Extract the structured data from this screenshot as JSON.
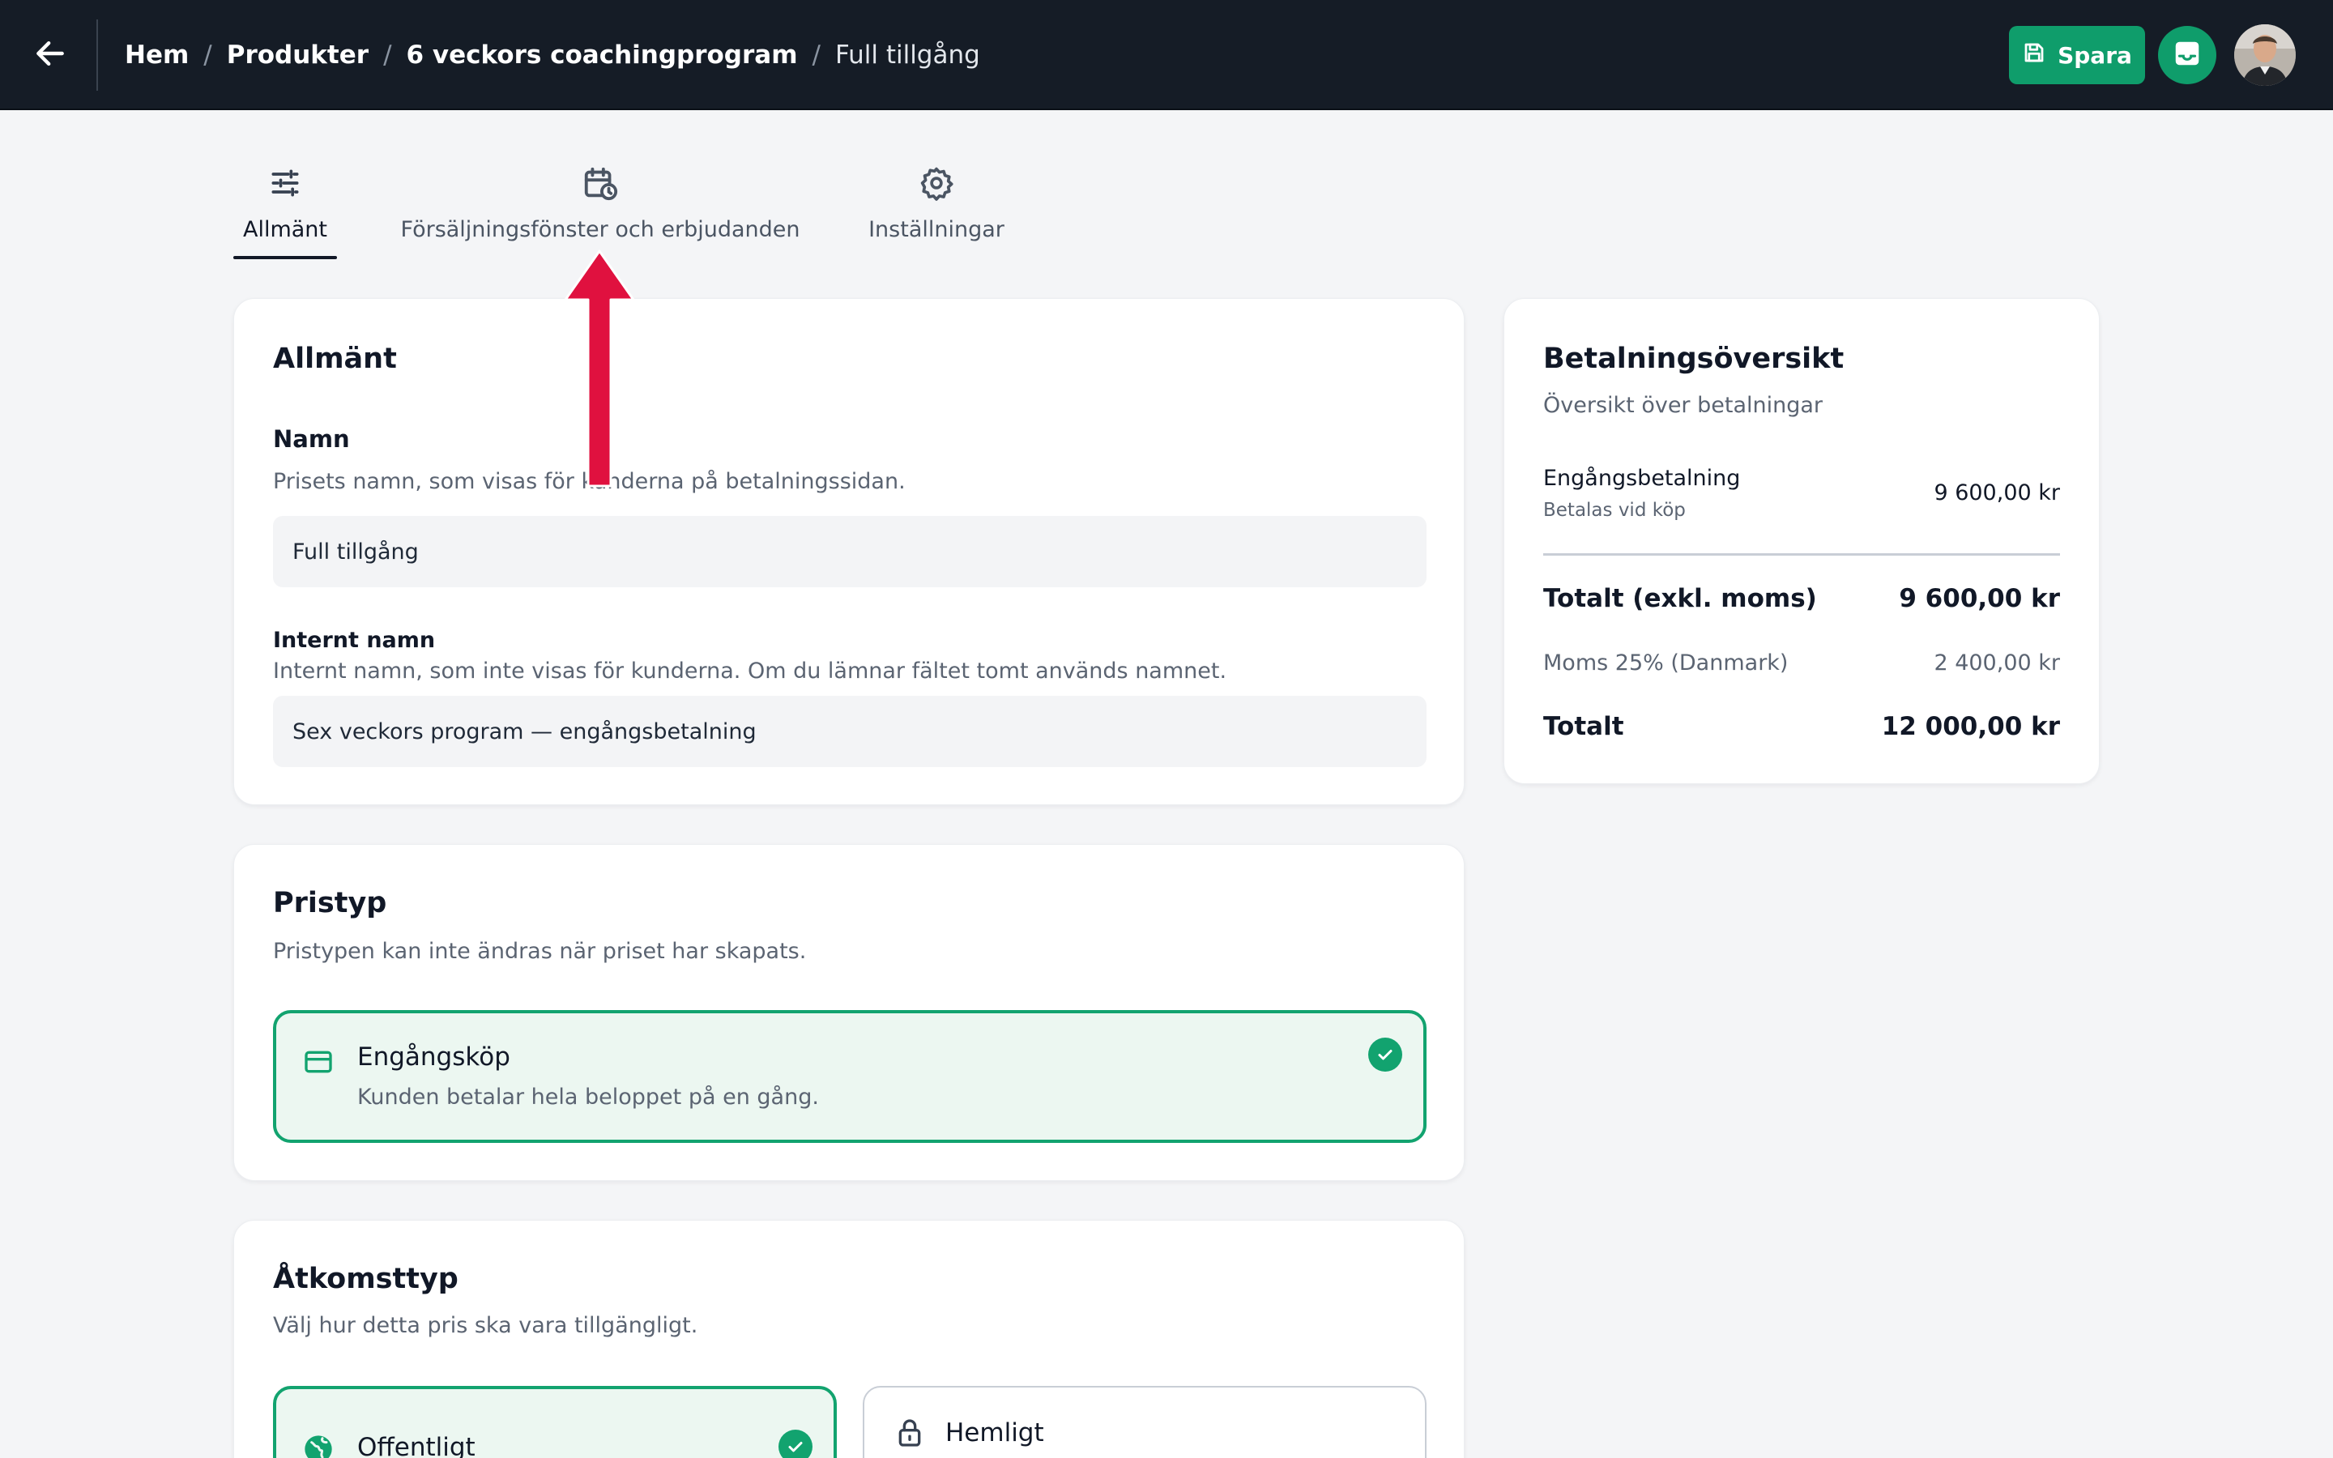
{
  "header": {
    "breadcrumb": [
      "Hem",
      "Produkter",
      "6 veckors coachingprogram"
    ],
    "current": "Full tillgång",
    "separator": "/",
    "save_label": "Spara",
    "colors": {
      "bar": "#151c26",
      "accent": "#0f9d6b"
    },
    "icons": {
      "back": "arrow-left-icon",
      "save": "floppy-disk-icon",
      "inbox": "inbox-icon"
    }
  },
  "tabs": [
    {
      "label": "Allmänt",
      "icon": "sliders-icon",
      "active": true
    },
    {
      "label": "Försäljningsfönster och erbjudanden",
      "icon": "calendar-clock-icon",
      "active": false
    },
    {
      "label": "Inställningar",
      "icon": "gear-icon",
      "active": false
    }
  ],
  "general": {
    "title": "Allmänt",
    "name_label": "Namn",
    "name_help": "Prisets namn, som visas för kunderna på betalningssidan.",
    "name_value": "Full tillgång",
    "internal_label": "Internt namn",
    "internal_help": "Internt namn, som inte visas för kunderna. Om du lämnar fältet tomt används namnet.",
    "internal_value": "Sex veckors program — engångsbetalning"
  },
  "price_type": {
    "title": "Pristyp",
    "subtitle": "Pristypen kan inte ändras när priset har skapats.",
    "option_title": "Engångsköp",
    "option_desc": "Kunden betalar hela beloppet på en gång.",
    "selected": true,
    "icon": "credit-card-icon"
  },
  "access_type": {
    "title": "Åtkomsttyp",
    "subtitle": "Välj hur detta pris ska vara tillgängligt.",
    "options": [
      {
        "label": "Offentligt",
        "icon": "globe-icon",
        "selected": true
      },
      {
        "label": "Hemligt",
        "icon": "lock-icon",
        "selected": false
      }
    ]
  },
  "payment_overview": {
    "title": "Betalningsöversikt",
    "subtitle": "Översikt över betalningar",
    "line_label": "Engångsbetalning",
    "line_sub": "Betalas vid köp",
    "line_value": "9 600,00 kr",
    "subtotal_label": "Totalt (exkl. moms)",
    "subtotal_value": "9 600,00 kr",
    "vat_label": "Moms 25% (Danmark)",
    "vat_value": "2 400,00 kr",
    "total_label": "Totalt",
    "total_value": "12 000,00 kr"
  },
  "annotation": {
    "icon": "red-arrow-up-icon",
    "color": "#e0113f"
  }
}
